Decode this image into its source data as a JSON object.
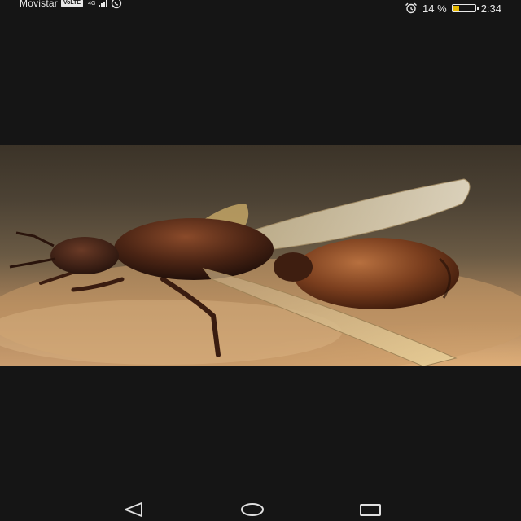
{
  "status_bar": {
    "carrier": "Movistar",
    "volte_label": "VoLTE",
    "network_type": "4G",
    "alarm_icon": "alarm-clock-icon",
    "battery_percent_text": "14 %",
    "battery_level": 0.14,
    "battery_color": "#e6b800",
    "time": "2:34"
  },
  "photo": {
    "subject_icon": "winged-ant-photo"
  },
  "navigation": {
    "back_icon": "back-triangle-icon",
    "home_icon": "home-circle-icon",
    "recent_icon": "recent-apps-square-icon"
  }
}
